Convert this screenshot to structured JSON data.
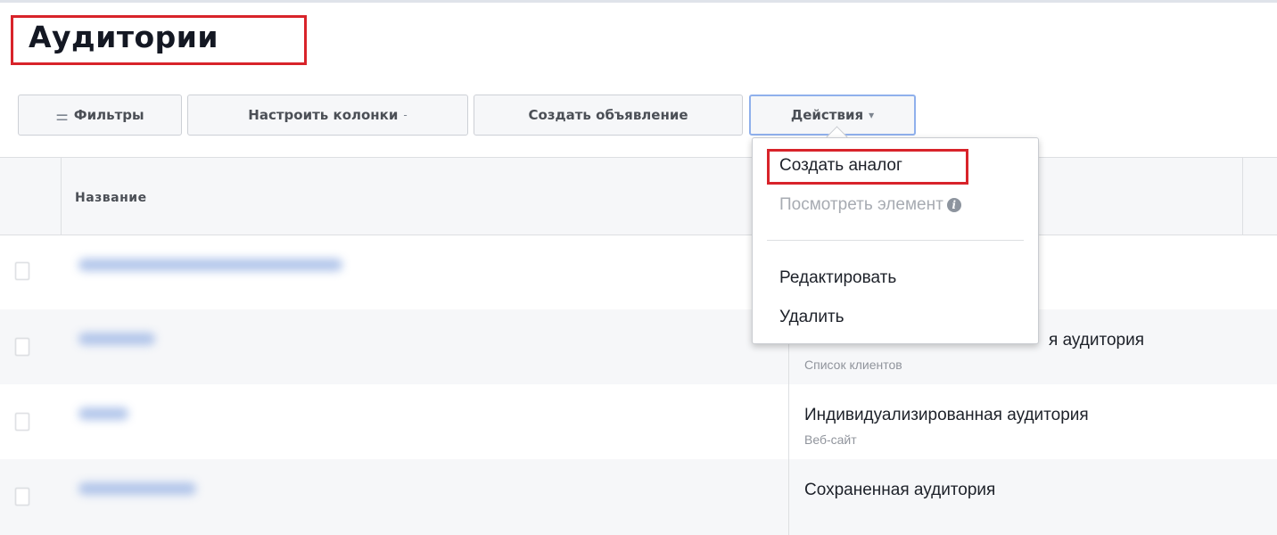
{
  "page": {
    "title": "Аудитории"
  },
  "toolbar": {
    "filters_icon": "filter-sliders-icon",
    "filters_label": "Фильтры",
    "columns_label": "Настроить колонки",
    "columns_caret": "-",
    "create_ad_label": "Создать объявление",
    "actions_label": "Действия",
    "actions_caret": "▾"
  },
  "table": {
    "columns": {
      "name": "Название"
    },
    "rows": [
      {
        "type": "",
        "subtype": ""
      },
      {
        "type": "я аудитория",
        "subtype": "Список клиентов"
      },
      {
        "type": "Индивидуализированная аудитория",
        "subtype": "Веб-сайт"
      },
      {
        "type": "Сохраненная аудитория",
        "subtype": ""
      }
    ]
  },
  "dropdown": {
    "items": [
      {
        "label": "Создать аналог",
        "enabled": true
      },
      {
        "label": "Посмотреть элемент",
        "enabled": false,
        "icon": "info-icon",
        "icon_glyph": "i"
      },
      {
        "label": "Редактировать",
        "enabled": true
      },
      {
        "label": "Удалить",
        "enabled": true
      }
    ]
  },
  "colors": {
    "highlight": "#d8232a",
    "active_border": "#8fb0ec",
    "header_bg": "#f6f7f9"
  }
}
